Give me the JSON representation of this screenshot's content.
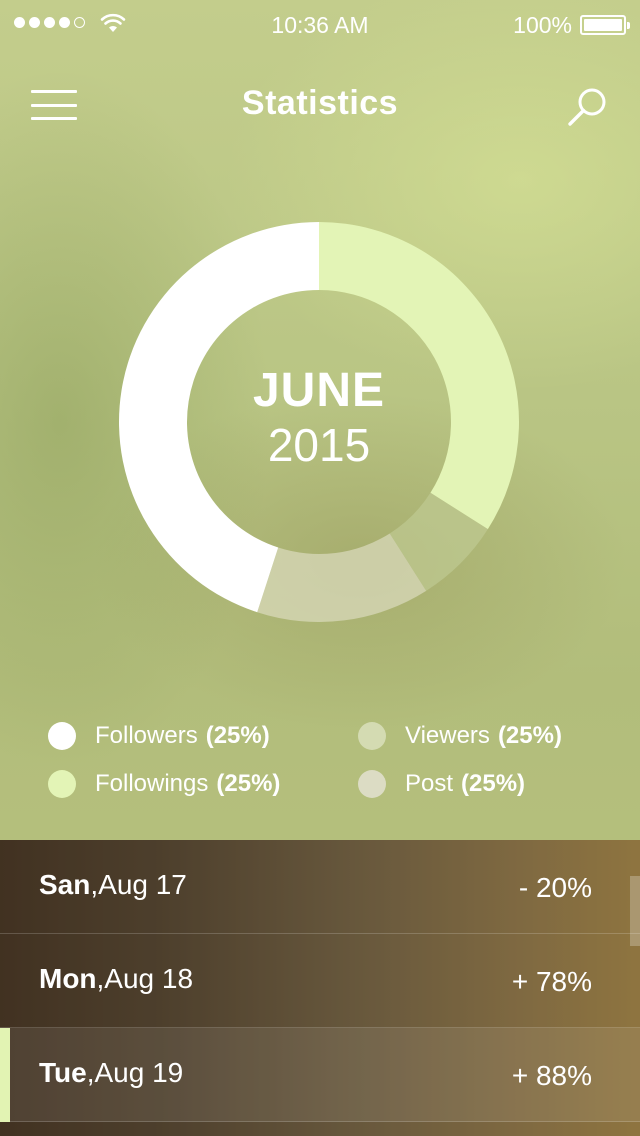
{
  "status_bar": {
    "time": "10:36 AM",
    "battery": "100%",
    "signal_dots_filled": 4,
    "signal_dots_total": 5
  },
  "header": {
    "title": "Statistics",
    "menu_icon": "hamburger-menu-icon",
    "search_icon": "search-icon"
  },
  "donut": {
    "month": "JUNE",
    "year": "2015",
    "segments": [
      {
        "name": "Followers",
        "fraction": 0.25,
        "color": "#ffffff"
      },
      {
        "name": "Followings",
        "fraction": 0.25,
        "color": "#e3f4b6"
      },
      {
        "name": "Viewers",
        "fraction": 0.25,
        "color": "#c5d09b"
      },
      {
        "name": "Post",
        "fraction": 0.25,
        "color": "#dcdcbf"
      }
    ]
  },
  "legend": [
    {
      "label": "Followers",
      "pct": "(25%)",
      "color": "#ffffff"
    },
    {
      "label": "Viewers",
      "pct": "(25%)",
      "color": "#d4dbb2"
    },
    {
      "label": "Followings",
      "pct": "(25%)",
      "color": "#e3f4b6"
    },
    {
      "label": "Post",
      "pct": "(25%)",
      "color": "#dcdcc4"
    }
  ],
  "stats": [
    {
      "day": "San",
      "date": ",Aug 17",
      "change": "- 20%"
    },
    {
      "day": "Mon",
      "date": ",Aug 18",
      "change": "+ 78%"
    },
    {
      "day": "Tue",
      "date": ",Aug 19",
      "change": "+ 88%",
      "active": true
    }
  ],
  "colors": {
    "accent": "#e2f3b3",
    "text": "#ffffff"
  }
}
